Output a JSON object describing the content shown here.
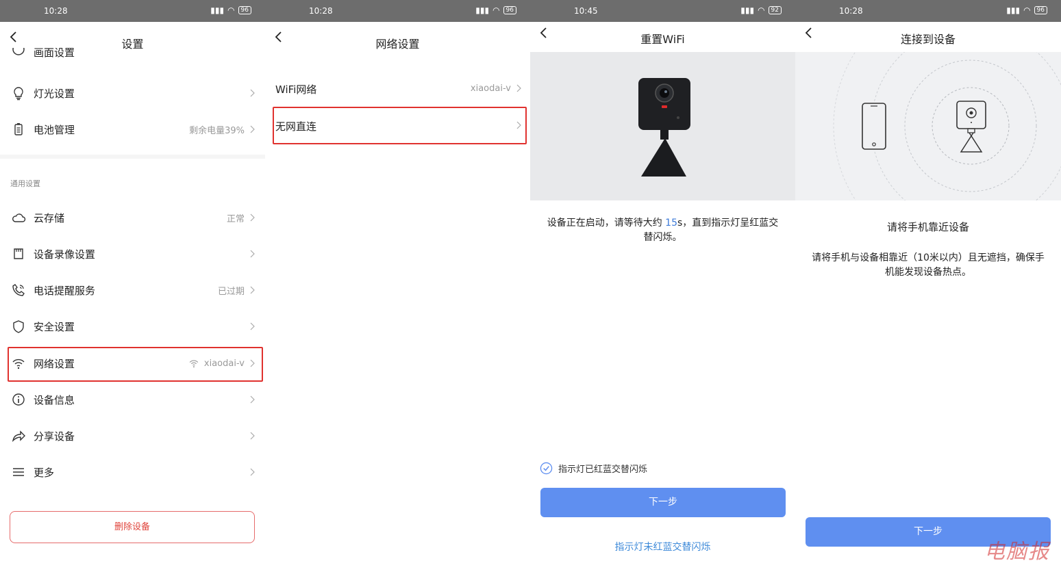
{
  "panel1": {
    "status": {
      "time": "10:28",
      "battery": "96"
    },
    "title": "设置",
    "partial_top_label": "画面设置",
    "items_top": [
      {
        "label": "灯光设置",
        "value": "",
        "icon": "bulb-icon"
      },
      {
        "label": "电池管理",
        "value": "剩余电量39%",
        "icon": "battery-icon"
      }
    ],
    "section_label": "通用设置",
    "items": [
      {
        "label": "云存储",
        "value": "正常",
        "icon": "cloud-icon"
      },
      {
        "label": "设备录像设置",
        "value": "",
        "icon": "sdcard-icon"
      },
      {
        "label": "电话提醒服务",
        "value": "已过期",
        "icon": "phone-icon"
      },
      {
        "label": "安全设置",
        "value": "",
        "icon": "shield-icon"
      },
      {
        "label": "网络设置",
        "value": "xiaodai-v",
        "icon": "wifi-icon"
      },
      {
        "label": "设备信息",
        "value": "",
        "icon": "info-icon"
      },
      {
        "label": "分享设备",
        "value": "",
        "icon": "share-icon"
      },
      {
        "label": "更多",
        "value": "",
        "icon": "menu-icon"
      }
    ],
    "delete_label": "删除设备"
  },
  "panel2": {
    "status": {
      "time": "10:28",
      "battery": "96"
    },
    "title": "网络设置",
    "rows": [
      {
        "label": "WiFi网络",
        "value": "xiaodai-v"
      },
      {
        "label": "无网直连",
        "value": ""
      }
    ]
  },
  "panel3": {
    "status": {
      "time": "10:45",
      "battery": "92"
    },
    "title": "重置WiFi",
    "desc_before": "设备正在启动，请等待大约 ",
    "desc_highlight": "15",
    "desc_after": "s，直到指示灯呈红蓝交替闪烁。",
    "check_label": "指示灯已红蓝交替闪烁",
    "next_label": "下一步",
    "link_label": "指示灯未红蓝交替闪烁"
  },
  "panel4": {
    "status": {
      "time": "10:28",
      "battery": "96"
    },
    "title": "连接到设备",
    "heading": "请将手机靠近设备",
    "desc": "请将手机与设备相靠近（10米以内）且无遮挡，确保手机能发现设备热点。",
    "next_label": "下一步"
  },
  "watermark": "电脑报",
  "colors": {
    "accent": "#5f8ff0",
    "highlight_box": "#e0312e",
    "danger": "#e0453c",
    "link": "#3e8ad9"
  }
}
